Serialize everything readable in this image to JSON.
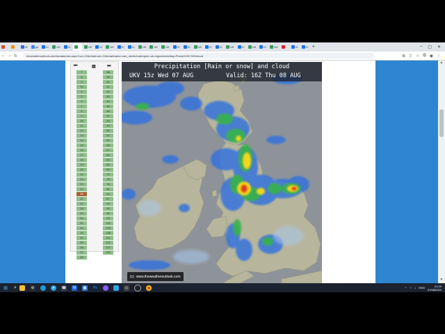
{
  "browser": {
    "tabs": [
      {
        "label": "",
        "color": "#e04a2a",
        "active": false
      },
      {
        "label": "",
        "color": "#ff8a00",
        "active": false
      },
      {
        "label": "W",
        "color": "#2e6bd6",
        "active": false
      },
      {
        "label": "go",
        "color": "#4285f4",
        "active": false
      },
      {
        "label": "IC",
        "color": "#1a73e8",
        "active": false
      },
      {
        "label": "UK",
        "color": "#3a9b5c",
        "active": false
      },
      {
        "label": "IC",
        "color": "#1a73e8",
        "active": false
      },
      {
        "label": "",
        "color": "#3a9b5c",
        "active": true
      },
      {
        "label": "UK",
        "color": "#3a9b5c",
        "active": false
      },
      {
        "label": "IC",
        "color": "#1a73e8",
        "active": false
      },
      {
        "label": "UK",
        "color": "#3a9b5c",
        "active": false
      },
      {
        "label": "IC",
        "color": "#1a73e8",
        "active": false
      },
      {
        "label": "IC",
        "color": "#1a73e8",
        "active": false
      },
      {
        "label": "UK",
        "color": "#3a9b5c",
        "active": false
      },
      {
        "label": "UK",
        "color": "#3a9b5c",
        "active": false
      },
      {
        "label": "UK",
        "color": "#3a9b5c",
        "active": false
      },
      {
        "label": "IC",
        "color": "#1a73e8",
        "active": false
      },
      {
        "label": "IC",
        "color": "#1a73e8",
        "active": false
      },
      {
        "label": "UK",
        "color": "#3a9b5c",
        "active": false
      },
      {
        "label": "IC",
        "color": "#1a73e8",
        "active": false
      },
      {
        "label": "IC",
        "color": "#1a73e8",
        "active": false
      },
      {
        "label": "UK",
        "color": "#3a9b5c",
        "active": false
      },
      {
        "label": "IC",
        "color": "#1a73e8",
        "active": false
      },
      {
        "label": "UK",
        "color": "#3a9b5c",
        "active": false
      },
      {
        "label": "IC",
        "color": "#1a73e8",
        "active": false
      },
      {
        "label": "UK",
        "color": "#3a9b5c",
        "active": false
      },
      {
        "label": "",
        "color": "#e02020",
        "active": false
      },
      {
        "label": "IC",
        "color": "#1a73e8",
        "active": false
      },
      {
        "label": "IC",
        "color": "#1a73e8",
        "active": false
      }
    ],
    "url": "theweatheroutlook.com/twodata/ukv.aspx?run=15&chartnum=24&chartname=rain_rate&chartregion=uk-region&charttag=Precip%20+%20cloud"
  },
  "hours": {
    "left": [
      "7",
      "8",
      "9",
      "10",
      "4",
      "5",
      "6",
      "7",
      "8",
      "9",
      "10",
      "11",
      "12",
      "13",
      "14",
      "15",
      "16",
      "17",
      "18",
      "19",
      "20",
      "21",
      "22",
      "23",
      "24",
      "25",
      "26",
      "27",
      "28",
      "29",
      "30",
      "31",
      "32",
      "33",
      "34",
      "35",
      "36",
      "37",
      "38"
    ],
    "right": [
      "38",
      "39",
      "40",
      "41",
      "42",
      "43",
      "44",
      "45",
      "46",
      "47",
      "48",
      "49",
      "50",
      "51",
      "52",
      "54",
      "57",
      "60",
      "63",
      "66",
      "69",
      "72",
      "75",
      "78",
      "81",
      "84",
      "87",
      "90",
      "93",
      "96",
      "99",
      "102",
      "105",
      "108",
      "111",
      "114",
      "117",
      "120"
    ],
    "current_index": 25
  },
  "map": {
    "title": "Precipitation [Rain or snow] and cloud",
    "run": "UKV 15z Wed 07 AUG",
    "valid": "Valid: 16Z Thu 08 AUG",
    "credit_prefix": "(c)",
    "credit": "www.theweatheroutlook.com"
  },
  "taskbar": {
    "time": "21:20",
    "date": "07/08/2024",
    "lang": "ENG"
  }
}
